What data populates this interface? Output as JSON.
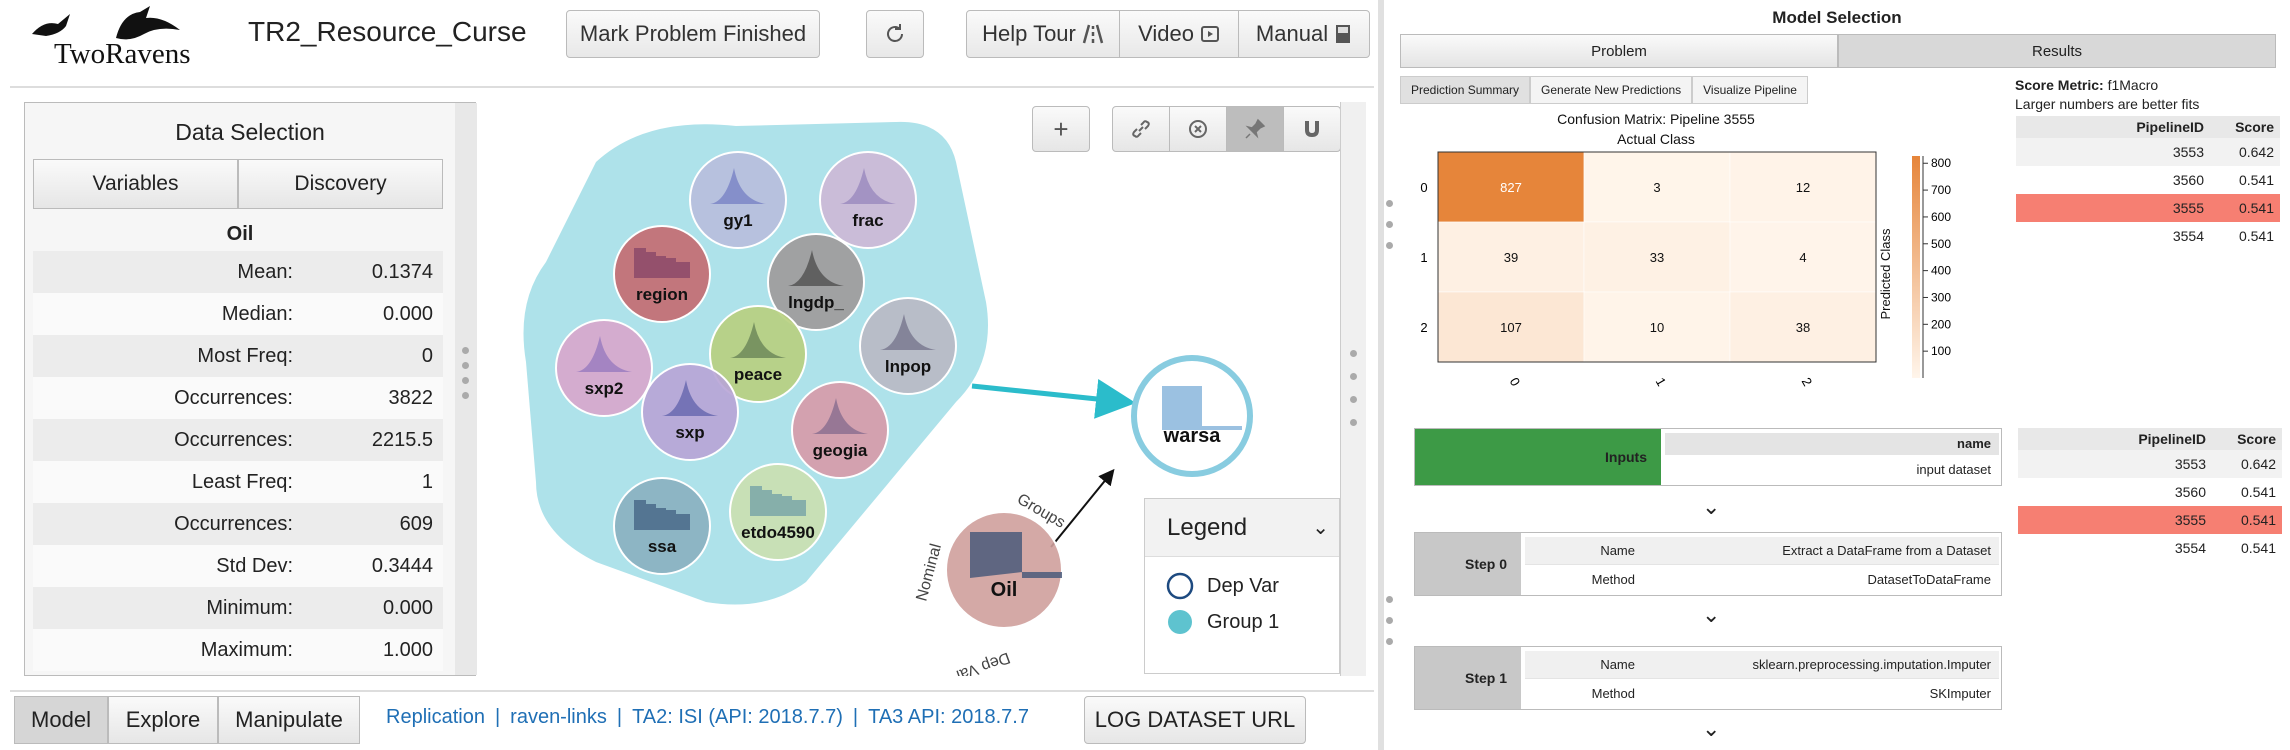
{
  "header": {
    "logo_text": "TwoRavens",
    "project_title": "TR2_Resource_Curse",
    "mark_finished_label": "Mark Problem Finished",
    "help_tour_label": "Help Tour",
    "video_label": "Video",
    "manual_label": "Manual"
  },
  "data_selection": {
    "title": "Data Selection",
    "tabs": [
      "Variables",
      "Discovery"
    ],
    "variable_name": "Oil",
    "stats": [
      {
        "label": "Mean:",
        "value": "0.1374"
      },
      {
        "label": "Median:",
        "value": "0.000"
      },
      {
        "label": "Most Freq:",
        "value": "0"
      },
      {
        "label": "Occurrences:",
        "value": "3822"
      },
      {
        "label": "Occurrences:",
        "value": "2215.5"
      },
      {
        "label": "Least Freq:",
        "value": "1"
      },
      {
        "label": "Occurrences:",
        "value": "609"
      },
      {
        "label": "Std Dev:",
        "value": "0.3444"
      },
      {
        "label": "Minimum:",
        "value": "0.000"
      },
      {
        "label": "Maximum:",
        "value": "1.000"
      }
    ]
  },
  "graph": {
    "nodes": [
      "gy1",
      "frac",
      "region",
      "lngdp_",
      "sxp2",
      "peace",
      "lnpop",
      "sxp",
      "geogia",
      "ssa",
      "etdo4590",
      "warsa",
      "Oil"
    ],
    "oil_labels": {
      "group": "Groups",
      "nominal": "Nominal",
      "dep": "Dep Var"
    },
    "legend": {
      "title": "Legend",
      "items": [
        "Dep Var",
        "Group 1"
      ]
    },
    "colors": {
      "group_hull": "#aee2ea",
      "arrow": "#2bbccb",
      "dep_ring": "#88cce0"
    }
  },
  "bottom": {
    "tabs": [
      "Model",
      "Explore",
      "Manipulate"
    ],
    "links": [
      "Replication",
      "raven-links",
      "TA2: ISI (API: 2018.7.7)",
      "TA3 API: 2018.7.7"
    ],
    "log_button": "LOG DATASET URL"
  },
  "results": {
    "title": "Model Selection",
    "tabs": [
      "Problem",
      "Results"
    ],
    "sub_tabs": [
      "Prediction Summary",
      "Generate New Predictions",
      "Visualize Pipeline"
    ],
    "score_metric_label": "Score Metric:",
    "score_metric": "f1Macro",
    "score_note": "Larger numbers are better fits",
    "table_headers": [
      "PipelineID",
      "Score"
    ],
    "pipelines": [
      {
        "id": "3553",
        "score": "0.642"
      },
      {
        "id": "3560",
        "score": "0.541"
      },
      {
        "id": "3555",
        "score": "0.541"
      },
      {
        "id": "3554",
        "score": "0.541"
      }
    ],
    "selected_pipeline": "3555",
    "pipeline_steps": {
      "inputs_label": "Inputs",
      "inputs_header": "name",
      "inputs_value": "input dataset",
      "steps": [
        {
          "label": "Step 0",
          "name_key": "Name",
          "name": "Extract a DataFrame from a Dataset",
          "method_key": "Method",
          "method": "DatasetToDataFrame"
        },
        {
          "label": "Step 1",
          "name_key": "Name",
          "name": "sklearn.preprocessing.imputation.Imputer",
          "method_key": "Method",
          "method": "SKImputer"
        }
      ]
    }
  },
  "chart_data": {
    "type": "heatmap",
    "title": "Confusion Matrix: Pipeline 3555",
    "xlabel": "Actual Class",
    "ylabel": "Predicted Class",
    "row_labels": [
      "0",
      "1",
      "2"
    ],
    "col_labels": [
      "0",
      "1",
      "2"
    ],
    "values": [
      [
        827,
        3,
        12
      ],
      [
        39,
        33,
        4
      ],
      [
        107,
        10,
        38
      ]
    ],
    "colorbar_ticks": [
      100,
      200,
      300,
      400,
      500,
      600,
      700,
      800
    ],
    "colorbar_range": [
      0,
      827
    ],
    "colormap": [
      "#fff5eb",
      "#e6853a"
    ]
  }
}
